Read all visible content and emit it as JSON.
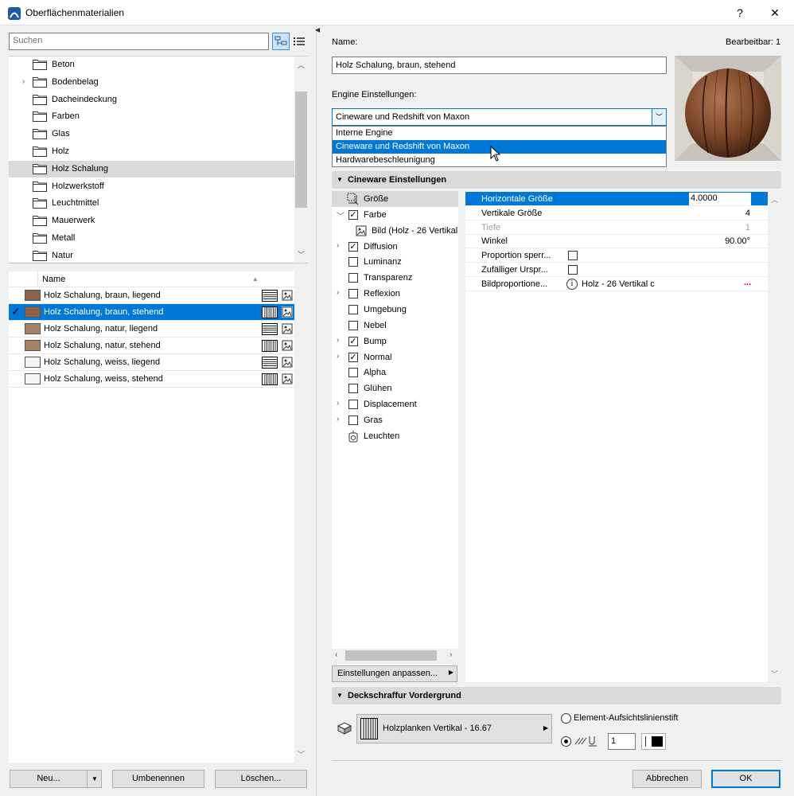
{
  "window": {
    "title": "Oberflächenmaterialien",
    "help": "?",
    "close": "✕"
  },
  "left": {
    "search_placeholder": "Suchen",
    "folders": [
      {
        "label": "Beton",
        "expandable": false,
        "selected": false
      },
      {
        "label": "Bodenbelag",
        "expandable": true,
        "selected": false
      },
      {
        "label": "Dacheindeckung",
        "expandable": false,
        "selected": false
      },
      {
        "label": "Farben",
        "expandable": false,
        "selected": false
      },
      {
        "label": "Glas",
        "expandable": false,
        "selected": false
      },
      {
        "label": "Holz",
        "expandable": false,
        "selected": false
      },
      {
        "label": "Holz Schalung",
        "expandable": false,
        "selected": true
      },
      {
        "label": "Holzwerkstoff",
        "expandable": false,
        "selected": false
      },
      {
        "label": "Leuchtmittel",
        "expandable": false,
        "selected": false
      },
      {
        "label": "Mauerwerk",
        "expandable": false,
        "selected": false
      },
      {
        "label": "Metall",
        "expandable": false,
        "selected": false
      },
      {
        "label": "Natur",
        "expandable": false,
        "selected": false
      }
    ],
    "list_header": "Name",
    "materials": [
      {
        "label": "Holz Schalung, braun, liegend",
        "swatch": "#8b6148",
        "hatch": "horizontal",
        "selected": false
      },
      {
        "label": "Holz Schalung, braun, stehend",
        "swatch": "#8b6148",
        "hatch": "vertical",
        "selected": true
      },
      {
        "label": "Holz Schalung, natur, liegend",
        "swatch": "#a68364",
        "hatch": "horizontal",
        "selected": false
      },
      {
        "label": "Holz Schalung, natur, stehend",
        "swatch": "#a68364",
        "hatch": "vertical",
        "selected": false
      },
      {
        "label": "Holz Schalung, weiss, liegend",
        "swatch": "#f4f4f4",
        "hatch": "horizontal",
        "selected": false
      },
      {
        "label": "Holz Schalung, weiss, stehend",
        "swatch": "#f4f4f4",
        "hatch": "vertical",
        "selected": false
      }
    ],
    "buttons": {
      "new": "Neu...",
      "rename": "Umbenennen",
      "delete": "Löschen..."
    }
  },
  "right": {
    "name_label": "Name:",
    "editable": "Bearbeitbar: 1",
    "name_value": "Holz Schalung, braun, stehend",
    "engine_label": "Engine Einstellungen:",
    "engine_value": "Cineware und Redshift von Maxon",
    "engine_options": [
      {
        "label": "Interne Engine",
        "selected": false
      },
      {
        "label": "Cineware und Redshift von Maxon",
        "selected": true
      },
      {
        "label": "Hardwarebeschleunigung",
        "selected": false
      }
    ],
    "cineware_title": "Cineware Einstellungen",
    "channels": [
      {
        "label": "Größe",
        "kind": "icon",
        "icon": "size-icon",
        "expander": false,
        "selected": true
      },
      {
        "label": "Farbe",
        "kind": "check",
        "checked": true,
        "expander": "open"
      },
      {
        "label": "Bild (Holz - 26 Vertikal",
        "kind": "icon",
        "icon": "image-icon",
        "expander": false,
        "indent": true
      },
      {
        "label": "Diffusion",
        "kind": "check",
        "checked": true,
        "expander": "closed"
      },
      {
        "label": "Luminanz",
        "kind": "check",
        "checked": false,
        "expander": false
      },
      {
        "label": "Transparenz",
        "kind": "check",
        "checked": false,
        "expander": false
      },
      {
        "label": "Reflexion",
        "kind": "check",
        "checked": false,
        "expander": "closed"
      },
      {
        "label": "Umgebung",
        "kind": "check",
        "checked": false,
        "expander": false
      },
      {
        "label": "Nebel",
        "kind": "check",
        "checked": false,
        "expander": false
      },
      {
        "label": "Bump",
        "kind": "check",
        "checked": true,
        "expander": "closed"
      },
      {
        "label": "Normal",
        "kind": "check",
        "checked": true,
        "expander": "closed"
      },
      {
        "label": "Alpha",
        "kind": "check",
        "checked": false,
        "expander": false
      },
      {
        "label": "Glühen",
        "kind": "check",
        "checked": false,
        "expander": false
      },
      {
        "label": "Displacement",
        "kind": "check",
        "checked": false,
        "expander": "closed"
      },
      {
        "label": "Gras",
        "kind": "check",
        "checked": false,
        "expander": "closed"
      },
      {
        "label": "Leuchten",
        "kind": "icon",
        "icon": "light-icon",
        "expander": false
      }
    ],
    "settings_button": "Einstellungen anpassen...",
    "properties": [
      {
        "name": "Horizontale Größe",
        "value": "4.0000",
        "type": "input",
        "selected": true
      },
      {
        "name": "Vertikale Größe",
        "value": "4",
        "type": "text"
      },
      {
        "name": "Tiefe",
        "value": "1",
        "type": "text",
        "disabled": true
      },
      {
        "name": "Winkel",
        "value": "90.00°",
        "type": "text"
      },
      {
        "name": "Proportion sperr...",
        "value": "",
        "type": "checkbox"
      },
      {
        "name": "Zufälliger Urspr...",
        "value": "",
        "type": "checkbox"
      },
      {
        "name": "Bildproportione...",
        "value": "Holz - 26 Vertikal c",
        "type": "info",
        "more": "..."
      }
    ],
    "deck_title": "Deckschraffur Vordergrund",
    "hatch_label": "Holzplanken Vertikal - 16.67",
    "pen_radio": "Element-Aufsichtslinienstift",
    "pen_number": "1",
    "buttons": {
      "cancel": "Abbrechen",
      "ok": "OK"
    }
  }
}
